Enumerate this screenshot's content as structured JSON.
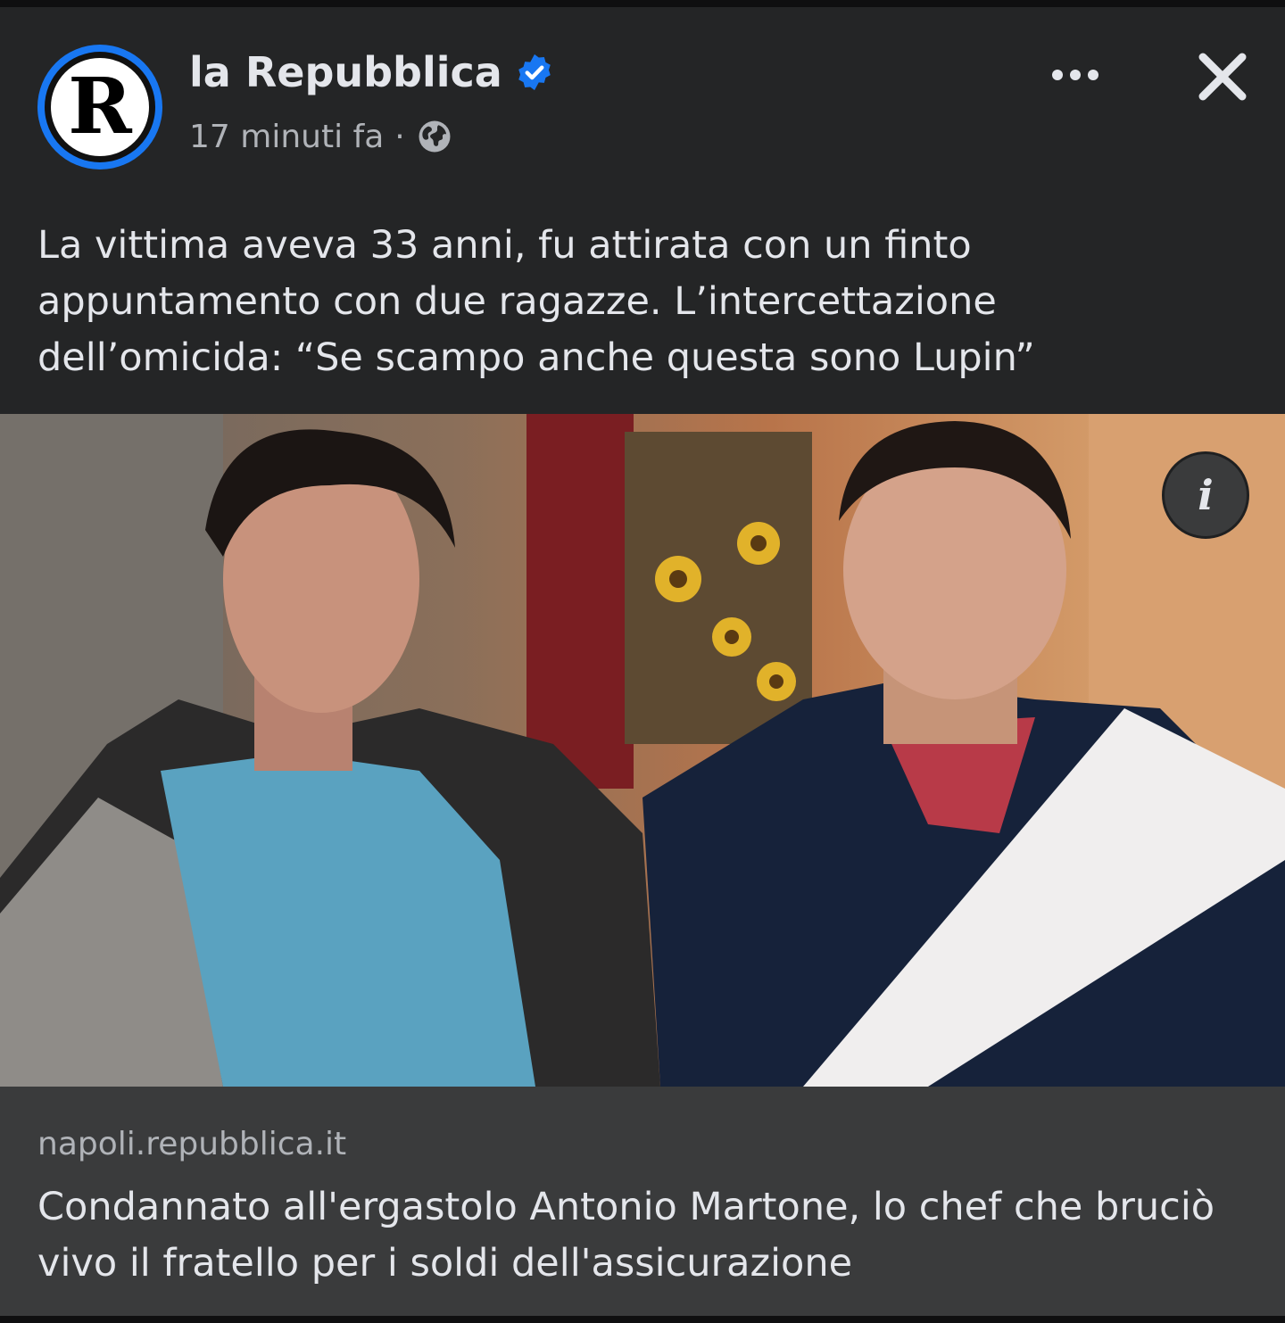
{
  "post": {
    "page_name": "la Repubblica",
    "avatar_letter": "R",
    "time_ago": "17 minuti fa",
    "separator": "·",
    "verified_icon": "verified-badge-icon",
    "audience_icon": "globe-icon",
    "text": "La vittima aveva 33 anni, fu attirata con un finto appuntamento con due ragazze. L’intercettazione dell’omicida: “Se scampo anche questa sono Lupin”"
  },
  "actions": {
    "more_icon": "more-options-icon",
    "close_icon": "close-icon"
  },
  "image": {
    "info_label": "i"
  },
  "link_preview": {
    "domain": "napoli.repubblica.it",
    "title": "Condannato all'ergastolo Antonio Martone, lo chef che bruciò vivo il fratello per i soldi dell'assicurazione"
  },
  "colors": {
    "background": "#242526",
    "link_box": "#3a3b3c",
    "accent_blue": "#1877f2",
    "primary_text": "#e4e6eb",
    "secondary_text": "#b0b3b8"
  }
}
